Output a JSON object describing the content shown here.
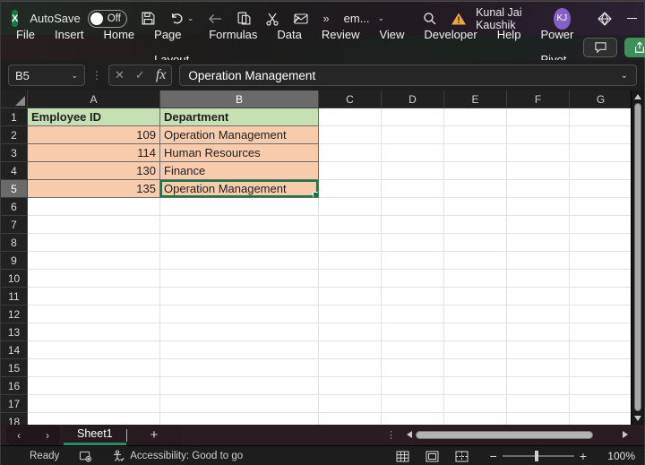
{
  "titlebar": {
    "autosave_label": "AutoSave",
    "autosave_state": "Off",
    "doc_name": "em...",
    "overflow_glyph": "»",
    "user_name": "Kunal Jai Kaushik",
    "avatar_initials": "KJ"
  },
  "menubar": {
    "items": [
      "File",
      "Insert",
      "Home",
      "Page Layout",
      "Formulas",
      "Data",
      "Review",
      "View",
      "Developer",
      "Help",
      "Power Pivot"
    ]
  },
  "formula_bar": {
    "name_box": "B5",
    "fx_label": "fx",
    "value": "Operation Management"
  },
  "grid": {
    "columns": [
      "A",
      "B",
      "C",
      "D",
      "E",
      "F",
      "G"
    ],
    "visible_rows": 18,
    "selection": {
      "cell": "B5",
      "column": "B",
      "row": 5
    },
    "table": {
      "headers": [
        "Employee ID",
        "Department"
      ],
      "rows": [
        {
          "employee_id": "109",
          "department": "Operation Management"
        },
        {
          "employee_id": "114",
          "department": "Human Resources"
        },
        {
          "employee_id": "130",
          "department": "Finance"
        },
        {
          "employee_id": "135",
          "department": "Operation Management"
        }
      ]
    },
    "colors": {
      "header_fill": "#c6e0b4",
      "data_fill": "#f8cbad",
      "selection_border": "#107c41"
    }
  },
  "sheet_tabs": {
    "tabs": [
      {
        "label": "Sheet1",
        "active": true
      }
    ],
    "add_label": "+"
  },
  "status_bar": {
    "mode": "Ready",
    "accessibility": "Accessibility: Good to go",
    "zoom_level": "100%"
  }
}
